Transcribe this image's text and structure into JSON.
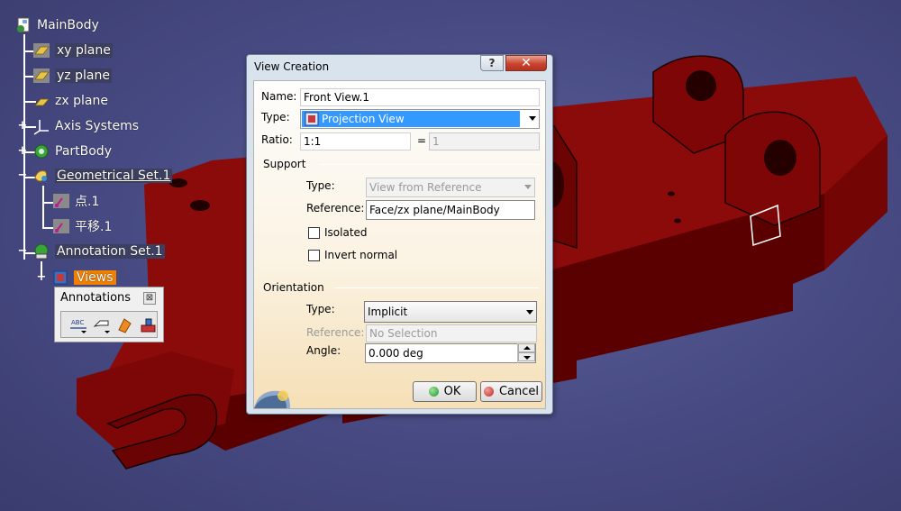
{
  "tree": {
    "nodes": [
      {
        "label": "MainBody",
        "icon": "part-document-icon"
      },
      {
        "label": "xy plane",
        "icon": "plane-icon"
      },
      {
        "label": "yz plane",
        "icon": "plane-icon"
      },
      {
        "label": "zx plane",
        "icon": "plane-icon"
      },
      {
        "label": "Axis Systems",
        "icon": "axis-system-icon"
      },
      {
        "label": "PartBody",
        "icon": "gear-icon"
      },
      {
        "label": "Geometrical Set.1",
        "icon": "geometrical-set-icon"
      },
      {
        "label": "点.1",
        "icon": "point-icon"
      },
      {
        "label": "平移.1",
        "icon": "translate-icon"
      },
      {
        "label": "Annotation Set.1",
        "icon": "annotation-set-icon"
      },
      {
        "label": "Views",
        "icon": "views-icon"
      }
    ]
  },
  "annotations_toolbar": {
    "title": "Annotations",
    "close_symbol": "⊠",
    "tools": [
      "text-annotation-icon",
      "flag-note-icon",
      "annotation-plane-icon",
      "annotation-view-icon"
    ]
  },
  "dialog": {
    "title": "View Creation",
    "help_symbol": "?",
    "close_symbol": "✕",
    "name_label": "Name:",
    "name_value": "Front View.1",
    "type_label": "Type:",
    "type_value": "Projection View",
    "ratio_label": "Ratio:",
    "ratio_value": "1:1",
    "ratio_equals": "=",
    "ratio_result": "1",
    "support": {
      "title": "Support",
      "type_label": "Type:",
      "type_value": "View from Reference",
      "reference_label": "Reference:",
      "reference_value": "Face/zx plane/MainBody",
      "isolated_label": "Isolated",
      "invert_label": "Invert normal"
    },
    "orientation": {
      "title": "Orientation",
      "type_label": "Type:",
      "type_value": "Implicit",
      "reference_label": "Reference:",
      "reference_value": "No Selection",
      "angle_label": "Angle:",
      "angle_value": "0.000 deg"
    },
    "ok_label": "OK",
    "cancel_label": "Cancel"
  },
  "colors": {
    "model": "#8b0a0a",
    "selected_node": "#f08000",
    "ok_dot": "#1f9a2a",
    "cancel_dot": "#c0241a"
  }
}
